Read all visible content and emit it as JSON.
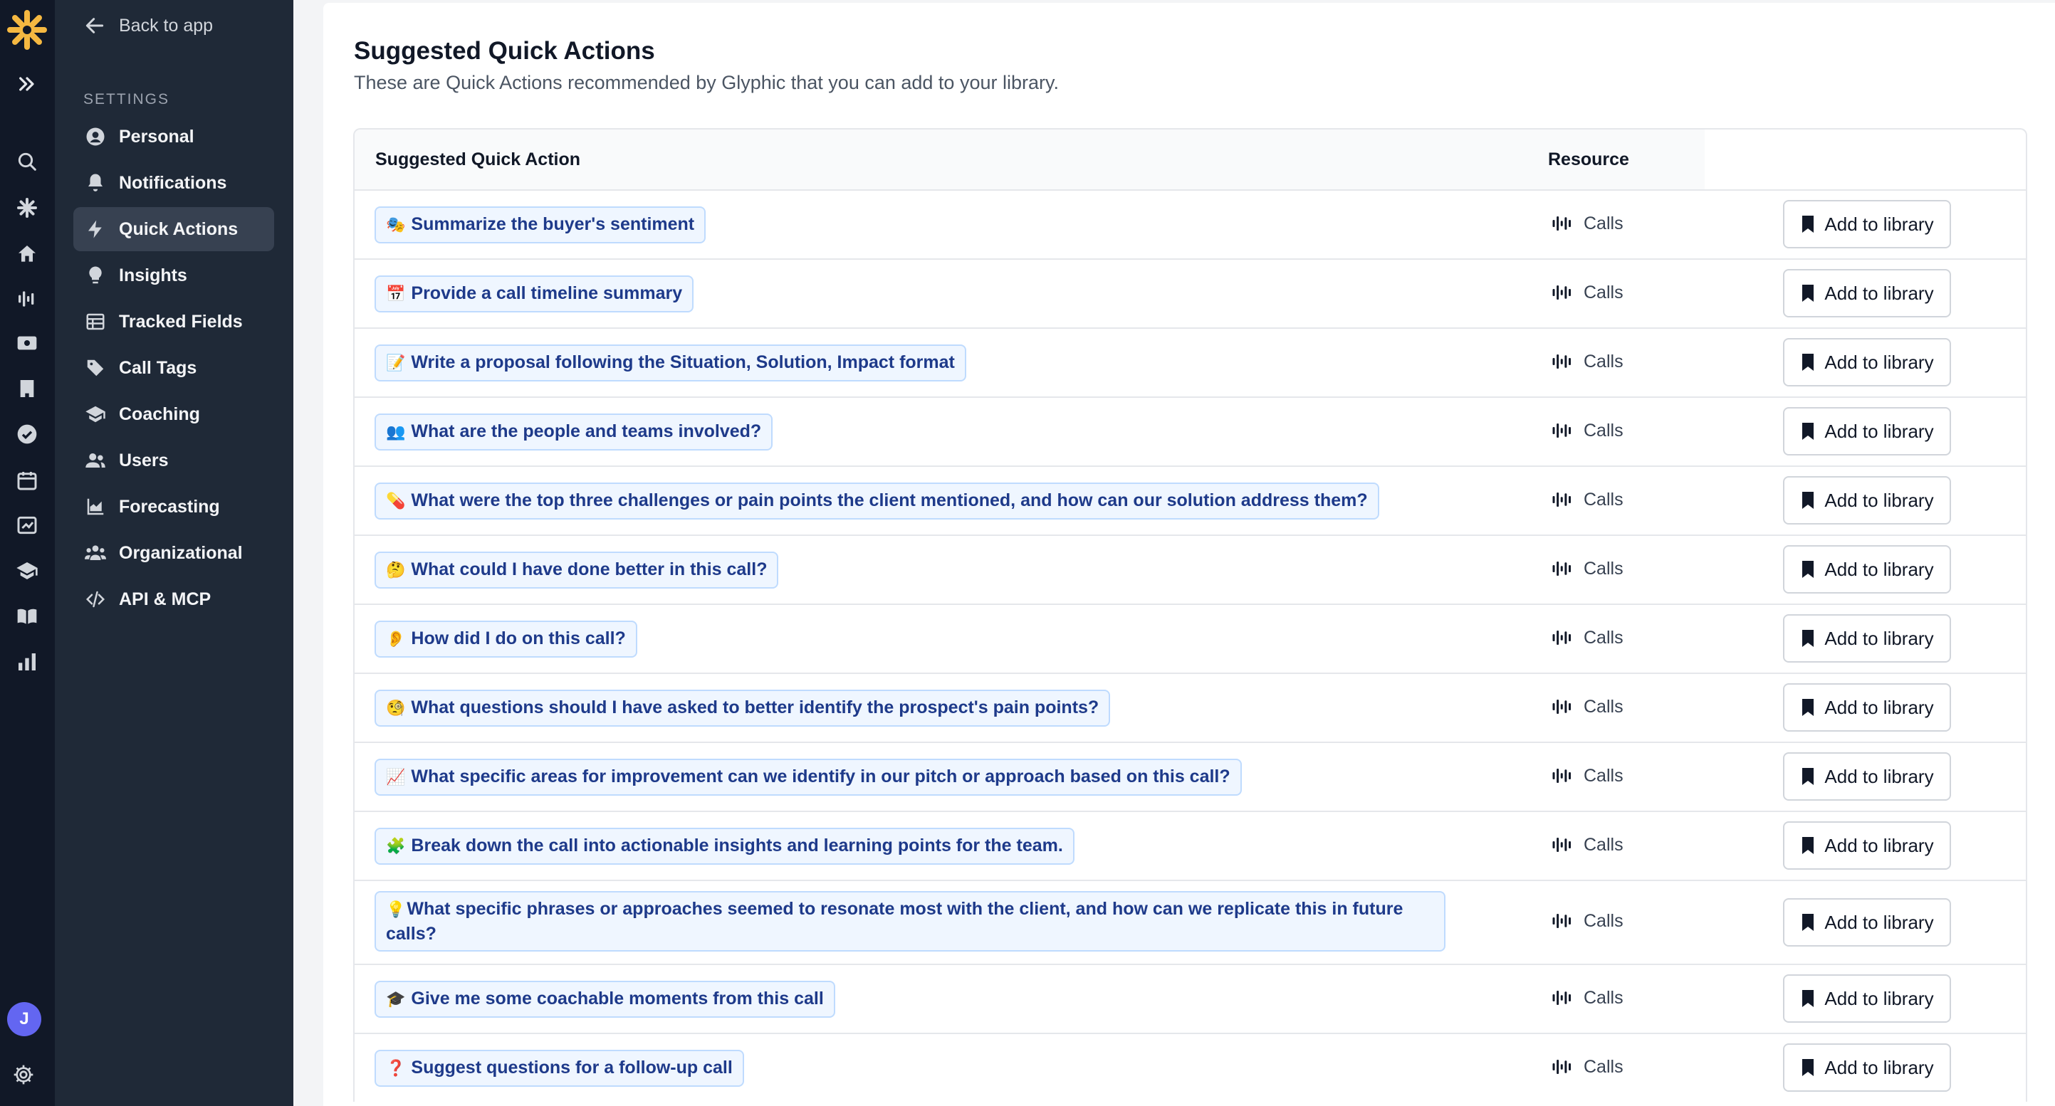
{
  "nav": {
    "back_label": "Back to app",
    "section_label": "SETTINGS",
    "items": [
      {
        "label": "Personal",
        "icon": "user-circle-icon"
      },
      {
        "label": "Notifications",
        "icon": "bell-icon"
      },
      {
        "label": "Quick Actions",
        "icon": "lightning-icon",
        "active": true
      },
      {
        "label": "Insights",
        "icon": "lightbulb-icon"
      },
      {
        "label": "Tracked Fields",
        "icon": "table-icon"
      },
      {
        "label": "Call Tags",
        "icon": "tag-icon"
      },
      {
        "label": "Coaching",
        "icon": "graduation-cap-icon"
      },
      {
        "label": "Users",
        "icon": "users-icon"
      },
      {
        "label": "Forecasting",
        "icon": "chart-icon"
      },
      {
        "label": "Organizational",
        "icon": "org-icon"
      },
      {
        "label": "API & MCP",
        "icon": "code-icon"
      }
    ]
  },
  "rail": {
    "avatar_initial": "J",
    "accent_color": "#f5b841"
  },
  "page": {
    "title": "Suggested Quick Actions",
    "subtitle": "These are Quick Actions recommended by Glyphic that you can add to your library."
  },
  "table": {
    "headers": [
      "Suggested Quick Action",
      "Resource"
    ],
    "button_label": "Add to library",
    "rows": [
      {
        "emoji": "🎭",
        "text": "Summarize the buyer's sentiment",
        "resource": "Calls"
      },
      {
        "emoji": "📅",
        "text": "Provide a call timeline summary",
        "resource": "Calls"
      },
      {
        "emoji": "📝",
        "text": "Write a proposal following the Situation, Solution, Impact format",
        "resource": "Calls"
      },
      {
        "emoji": "👥",
        "text": "What are the people and teams involved?",
        "resource": "Calls"
      },
      {
        "emoji": "💊",
        "text": "What were the top three challenges or pain points the client mentioned, and how can our solution address them?",
        "resource": "Calls"
      },
      {
        "emoji": "🤔",
        "text": "What could I have done better in this call?",
        "resource": "Calls"
      },
      {
        "emoji": "👂",
        "text": "How did I do on this call?",
        "resource": "Calls"
      },
      {
        "emoji": "🧐",
        "text": "What questions should I have asked to better identify the prospect's pain points?",
        "resource": "Calls"
      },
      {
        "emoji": "📈",
        "text": "What specific areas for improvement can we identify in our pitch or approach based on this call?",
        "resource": "Calls"
      },
      {
        "emoji": "🧩",
        "text": "Break down the call into actionable insights and learning points for the team.",
        "resource": "Calls"
      },
      {
        "emoji": "💡",
        "text": "What specific phrases or approaches seemed to resonate most with the client, and how can we replicate this in future calls?",
        "resource": "Calls",
        "wrap": true
      },
      {
        "emoji": "🎓",
        "text": "Give me some coachable moments from this call",
        "resource": "Calls"
      },
      {
        "emoji": "❓",
        "text": "Suggest questions for a follow-up call",
        "resource": "Calls"
      }
    ]
  }
}
